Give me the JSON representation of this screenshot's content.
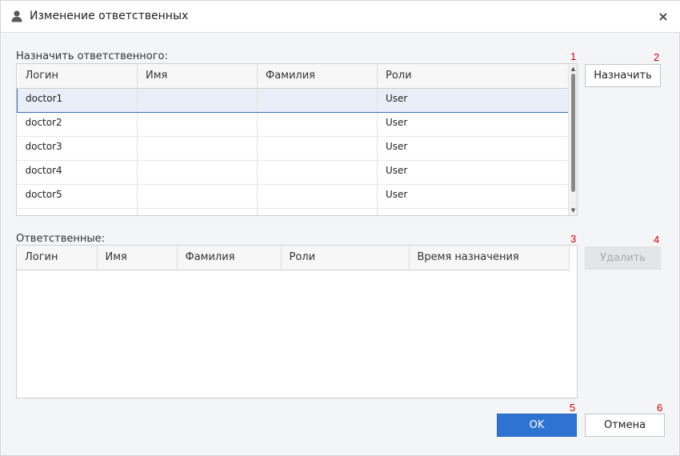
{
  "dialog": {
    "title": "Изменение ответственных",
    "close_glyph": "×",
    "icon": "user-icon"
  },
  "assign": {
    "label": "Назначить ответственного:",
    "columns": [
      "Логин",
      "Имя",
      "Фамилия",
      "Роли"
    ],
    "rows": [
      {
        "login": "doctor1",
        "first_name": "",
        "last_name": "",
        "roles": "User"
      },
      {
        "login": "doctor2",
        "first_name": "",
        "last_name": "",
        "roles": "User"
      },
      {
        "login": "doctor3",
        "first_name": "",
        "last_name": "",
        "roles": "User"
      },
      {
        "login": "doctor4",
        "first_name": "",
        "last_name": "",
        "roles": "User"
      },
      {
        "login": "doctor5",
        "first_name": "",
        "last_name": "",
        "roles": "User"
      }
    ],
    "selected_row": 0,
    "assign_button": "Назначить"
  },
  "responsible": {
    "label": "Ответственные:",
    "columns": [
      "Логин",
      "Имя",
      "Фамилия",
      "Роли",
      "Время назначения"
    ],
    "rows": [],
    "delete_button": "Удалить"
  },
  "footer": {
    "ok_button": "OK",
    "cancel_button": "Отмена"
  },
  "markers": [
    "1",
    "2",
    "3",
    "4",
    "5",
    "6"
  ],
  "colors": {
    "accent": "#2f73d2",
    "marker": "#d40000",
    "selection": "#e9eef8",
    "selection_border": "#3d6fb7"
  }
}
